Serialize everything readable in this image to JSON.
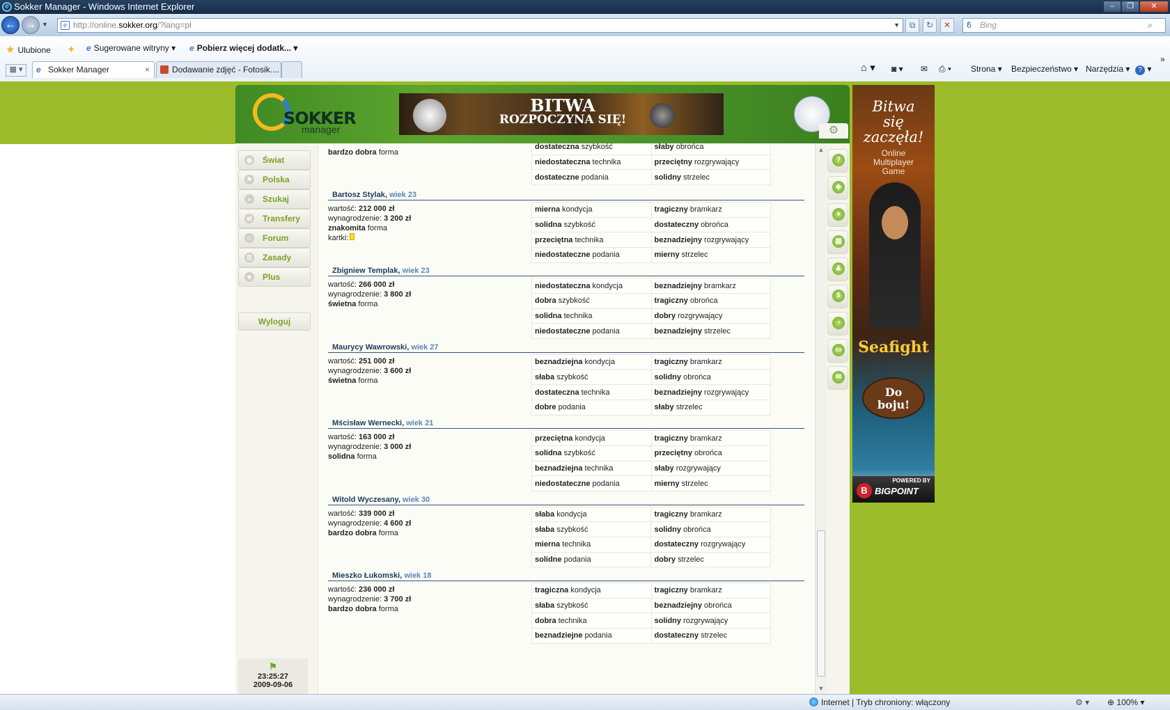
{
  "window": {
    "title": "Sokker Manager - Windows Internet Explorer"
  },
  "address": {
    "url_prefix": "http://online.",
    "url_domain": "sokker.org",
    "url_suffix": "/?lang=pl",
    "search_placeholder": "Bing"
  },
  "favorites": {
    "ulubione": "Ulubione",
    "sugerowane": "Sugerowane witryny",
    "pobierz": "Pobierz więcej dodatk..."
  },
  "tabs": [
    {
      "label": "Sokker Manager"
    },
    {
      "label": "Dodawanie zdjęć - Fotosik...."
    }
  ],
  "commands": {
    "strona": "Strona",
    "bezpieczenstwo": "Bezpieczeństwo",
    "narzedzia": "Narzędzia"
  },
  "header": {
    "logo_top": "SOKKER",
    "logo_bottom": "manager",
    "banner_line1": "BITWA",
    "banner_line2": "ROZPOCZYNA SIĘ!"
  },
  "nav": [
    {
      "label": "Świat",
      "icon": "globe-icon"
    },
    {
      "label": "Polska",
      "icon": "flag-icon"
    },
    {
      "label": "Szukaj",
      "icon": "search-icon"
    },
    {
      "label": "Transfery",
      "icon": "transfer-icon"
    },
    {
      "label": "Forum",
      "icon": "people-icon"
    },
    {
      "label": "Zasady",
      "icon": "rules-icon"
    },
    {
      "label": "Plus",
      "icon": "star-icon"
    }
  ],
  "logout": "Wyloguj",
  "clock": {
    "time": "23:25:27",
    "date": "2009-09-06"
  },
  "partial": {
    "form": "bardzo dobra",
    "form_label": "forma",
    "skills": [
      [
        "dostateczna",
        "szybkość",
        "słaby",
        "obrońca"
      ],
      [
        "niedostateczna",
        "technika",
        "przeciętny",
        "rozgrywający"
      ],
      [
        "dostateczne",
        "podania",
        "solidny",
        "strzelec"
      ]
    ]
  },
  "labels": {
    "age": "wiek",
    "value": "wartość:",
    "salary": "wynagrodzenie:",
    "form": "forma",
    "cards": "kartki:"
  },
  "players": [
    {
      "name": "Bartosz Stylak",
      "age": "23",
      "value": "212 000 zł",
      "salary": "3 200 zł",
      "form": "znakomita",
      "cards": 1,
      "skills": [
        [
          "mierna",
          "kondycja",
          "tragiczny",
          "bramkarz"
        ],
        [
          "solidna",
          "szybkość",
          "dostateczny",
          "obrońca"
        ],
        [
          "przeciętna",
          "technika",
          "beznadziejny",
          "rozgrywający"
        ],
        [
          "niedostateczne",
          "podania",
          "mierny",
          "strzelec"
        ]
      ]
    },
    {
      "name": "Zbigniew Templak",
      "age": "23",
      "value": "266 000 zł",
      "salary": "3 800 zł",
      "form": "świetna",
      "cards": 0,
      "skills": [
        [
          "niedostateczna",
          "kondycja",
          "beznadziejny",
          "bramkarz"
        ],
        [
          "dobra",
          "szybkość",
          "tragiczny",
          "obrońca"
        ],
        [
          "solidna",
          "technika",
          "dobry",
          "rozgrywający"
        ],
        [
          "niedostateczne",
          "podania",
          "beznadziejny",
          "strzelec"
        ]
      ]
    },
    {
      "name": "Maurycy Wawrowski",
      "age": "27",
      "value": "251 000 zł",
      "salary": "3 600 zł",
      "form": "świetna",
      "cards": 0,
      "skills": [
        [
          "beznadziejna",
          "kondycja",
          "tragiczny",
          "bramkarz"
        ],
        [
          "słaba",
          "szybkość",
          "solidny",
          "obrońca"
        ],
        [
          "dostateczna",
          "technika",
          "beznadziejny",
          "rozgrywający"
        ],
        [
          "dobre",
          "podania",
          "słaby",
          "strzelec"
        ]
      ]
    },
    {
      "name": "Mścisław Wernecki",
      "age": "21",
      "value": "163 000 zł",
      "salary": "3 000 zł",
      "form": "solidna",
      "cards": 0,
      "skills": [
        [
          "przeciętna",
          "kondycja",
          "tragiczny",
          "bramkarz"
        ],
        [
          "solidna",
          "szybkość",
          "przeciętny",
          "obrońca"
        ],
        [
          "beznadziejna",
          "technika",
          "słaby",
          "rozgrywający"
        ],
        [
          "niedostateczne",
          "podania",
          "mierny",
          "strzelec"
        ]
      ]
    },
    {
      "name": "Witold Wyczesany",
      "age": "30",
      "value": "339 000 zł",
      "salary": "4 600 zł",
      "form": "bardzo dobra",
      "cards": 0,
      "skills": [
        [
          "słaba",
          "kondycja",
          "tragiczny",
          "bramkarz"
        ],
        [
          "słaba",
          "szybkość",
          "solidny",
          "obrońca"
        ],
        [
          "mierna",
          "technika",
          "dostateczny",
          "rozgrywający"
        ],
        [
          "solidne",
          "podania",
          "dobry",
          "strzelec"
        ]
      ]
    },
    {
      "name": "Mieszko Łukomski",
      "age": "18",
      "value": "236 000 zł",
      "salary": "3 700 zł",
      "form": "bardzo dobra",
      "cards": 0,
      "skills": [
        [
          "tragiczna",
          "kondycja",
          "tragiczny",
          "bramkarz"
        ],
        [
          "słaba",
          "szybkość",
          "beznadziejny",
          "obrońca"
        ],
        [
          "dobra",
          "technika",
          "solidny",
          "rozgrywający"
        ],
        [
          "beznadziejne",
          "podania",
          "dostateczny",
          "strzelec"
        ]
      ]
    }
  ],
  "right_icons": [
    "help-icon",
    "shield-icon",
    "ball-icon",
    "tactics-icon",
    "training-icon",
    "money-icon",
    "stats-icon",
    "tv-icon",
    "mail-icon"
  ],
  "ad": {
    "headline1": "Bitwa",
    "headline2": "się zaczęła!",
    "sub1": "Online",
    "sub2": "Multiplayer",
    "sub3": "Game",
    "game": "Seafight",
    "cta1": "Do",
    "cta2": "boju!",
    "powered": "POWERED BY",
    "brand": "BIGPOINT"
  },
  "status": {
    "zone": "Internet | Tryb chroniony: włączony",
    "zoom": "100%"
  }
}
